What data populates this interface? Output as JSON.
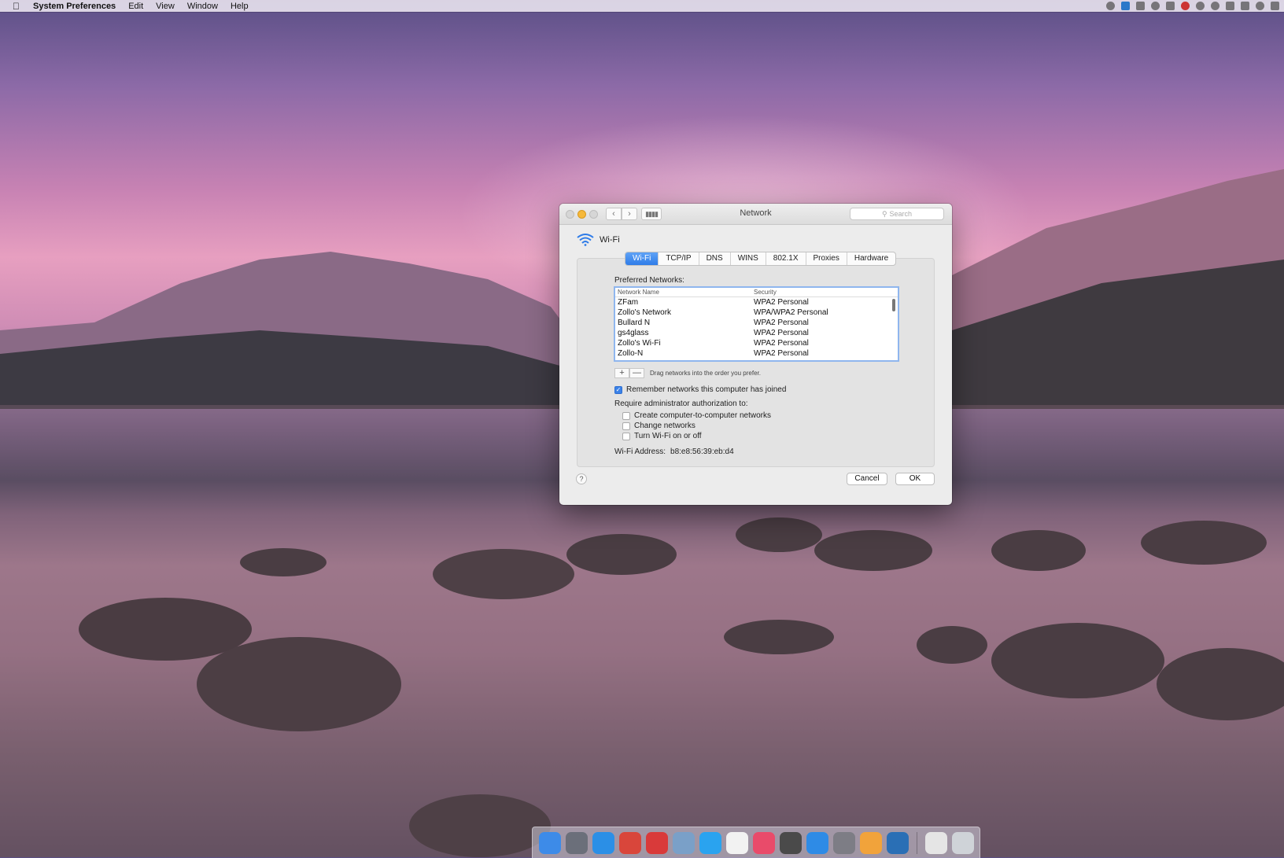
{
  "menubar": {
    "app": "System Preferences",
    "items": [
      "Edit",
      "View",
      "Window",
      "Help"
    ]
  },
  "window": {
    "title": "Network",
    "search_placeholder": "Search",
    "service": "Wi-Fi",
    "tabs": [
      {
        "label": "Wi-Fi",
        "active": true
      },
      {
        "label": "TCP/IP",
        "active": false
      },
      {
        "label": "DNS",
        "active": false
      },
      {
        "label": "WINS",
        "active": false
      },
      {
        "label": "802.1X",
        "active": false
      },
      {
        "label": "Proxies",
        "active": false
      },
      {
        "label": "Hardware",
        "active": false
      }
    ],
    "preferred_label": "Preferred Networks:",
    "columns": {
      "name": "Network Name",
      "security": "Security"
    },
    "networks": [
      {
        "name": "ZFam",
        "security": "WPA2 Personal"
      },
      {
        "name": "Zollo's Network",
        "security": "WPA/WPA2 Personal"
      },
      {
        "name": "Bullard N",
        "security": "WPA2 Personal"
      },
      {
        "name": "gs4glass",
        "security": "WPA2 Personal"
      },
      {
        "name": "Zollo's Wi-Fi",
        "security": "WPA2 Personal"
      },
      {
        "name": "Zollo-N",
        "security": "WPA2 Personal"
      }
    ],
    "plus": "+",
    "minus": "—",
    "drag_hint": "Drag networks into the order you prefer.",
    "remember": {
      "label": "Remember networks this computer has joined",
      "checked": true
    },
    "require_label": "Require administrator authorization to:",
    "require_options": [
      {
        "label": "Create computer-to-computer networks",
        "checked": false
      },
      {
        "label": "Change networks",
        "checked": false
      },
      {
        "label": "Turn Wi-Fi on or off",
        "checked": false
      }
    ],
    "wifi_address_label": "Wi-Fi Address:",
    "wifi_address": "b8:e8:56:39:eb:d4",
    "help": "?",
    "cancel": "Cancel",
    "ok": "OK"
  },
  "dock": [
    {
      "name": "finder-icon",
      "color": "#3d8be8"
    },
    {
      "name": "launchpad-icon",
      "color": "#6b6f7a"
    },
    {
      "name": "safari-icon",
      "color": "#2b8fe6"
    },
    {
      "name": "chrome-icon",
      "color": "#d9463b"
    },
    {
      "name": "opera-icon",
      "color": "#d93a3a"
    },
    {
      "name": "preview-icon",
      "color": "#7aa0c8"
    },
    {
      "name": "twitter-icon",
      "color": "#2aa3ef"
    },
    {
      "name": "calendar-icon",
      "color": "#f2f2f2"
    },
    {
      "name": "itunes-icon",
      "color": "#e94b6a"
    },
    {
      "name": "final-cut-icon",
      "color": "#4a4a4a"
    },
    {
      "name": "app-store-icon",
      "color": "#2e8be6"
    },
    {
      "name": "system-preferences-icon",
      "color": "#7d7d85"
    },
    {
      "name": "photos-icon",
      "color": "#f1a33b"
    },
    {
      "name": "quicktime-icon",
      "color": "#2a6fb5"
    },
    {
      "name": "downloads-stack-icon",
      "color": "#e5e5e5"
    },
    {
      "name": "trash-icon",
      "color": "#cfd3d8"
    }
  ]
}
